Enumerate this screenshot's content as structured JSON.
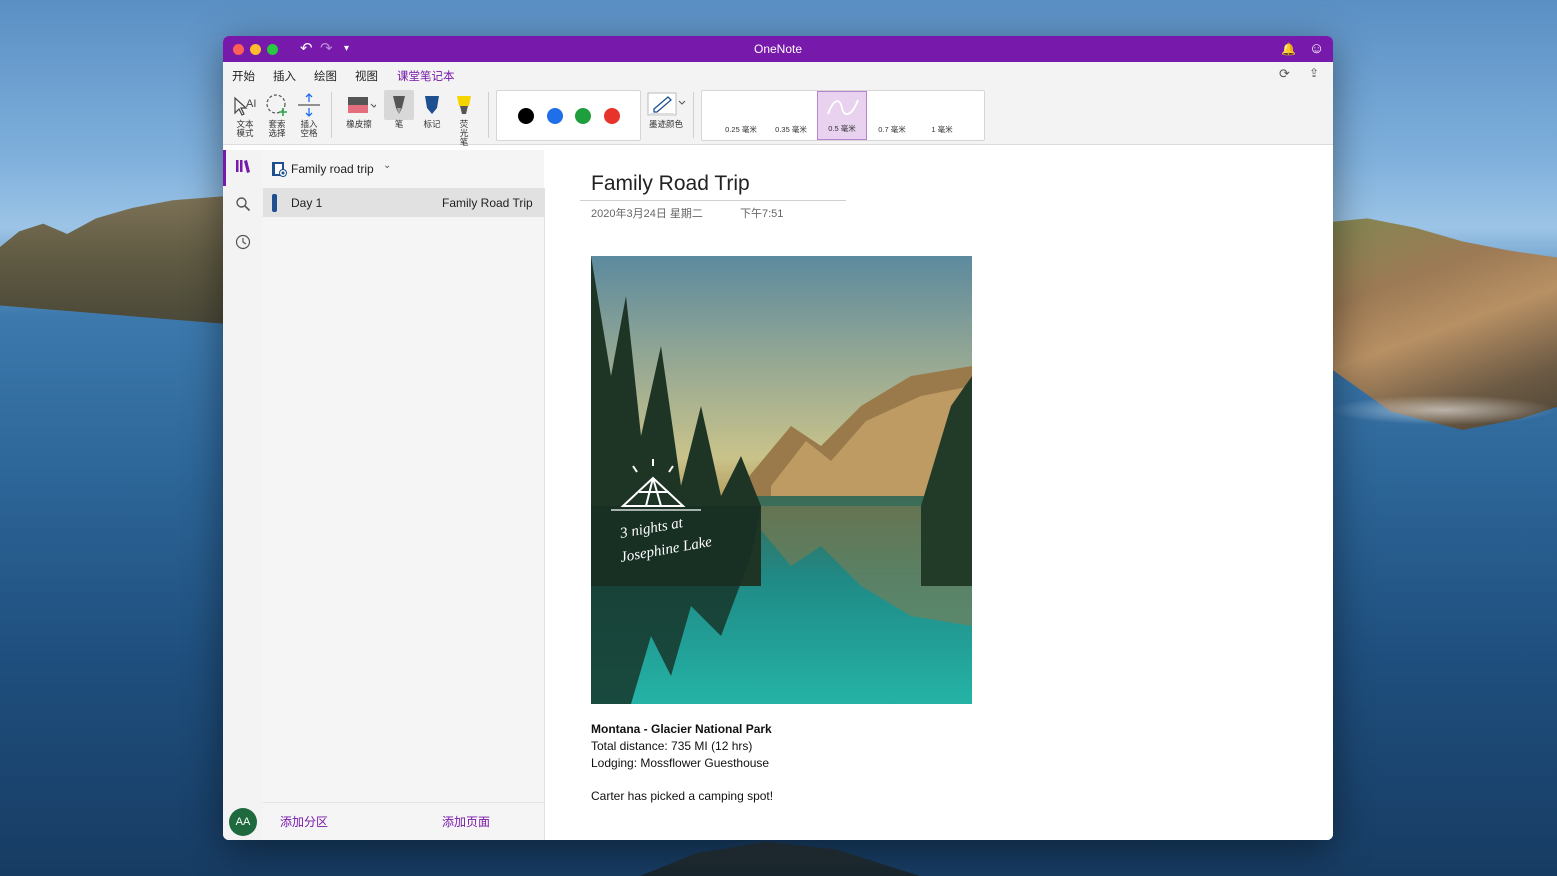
{
  "window": {
    "title": "OneNote"
  },
  "menu": {
    "tabs": [
      "开始",
      "插入",
      "绘图",
      "视图",
      "课堂笔记本"
    ],
    "active_tab": "绘图"
  },
  "ribbon": {
    "text_mode": "文本模式",
    "lasso_select": "套索选择",
    "insert_space": "插入空格",
    "eraser": "橡皮擦",
    "pen": "笔",
    "marker": "标记",
    "highlighter": "荧光笔",
    "ink_color": "墨迹颜色",
    "colors": [
      "#000000",
      "#1f6fe8",
      "#1e9e3c",
      "#e8332a"
    ],
    "thickness": [
      "0.25 毫米",
      "0.35 毫米",
      "0.5 毫米",
      "0.7 毫米",
      "1 毫米"
    ],
    "selected_thickness": "0.5 毫米"
  },
  "navigation": {
    "notebook_name": "Family road trip",
    "sections": [
      {
        "label": "Day 1"
      }
    ],
    "pages": [
      {
        "label": "Family Road Trip"
      }
    ],
    "add_section": "添加分区",
    "add_page": "添加页面",
    "avatar_initials": "AA"
  },
  "page": {
    "title": "Family Road Trip",
    "date": "2020年3月24日 星期二",
    "time": "下午7:51",
    "image_caption_line1": "3 nights at",
    "image_caption_line2": "Josephine Lake",
    "heading": "Montana - Glacier National Park",
    "lines": [
      "Total distance: 735 MI (12 hrs)",
      "Lodging: Mossflower Guesthouse",
      "Carter has picked a camping spot!"
    ]
  },
  "colors": {
    "accent": "#7719aa"
  }
}
